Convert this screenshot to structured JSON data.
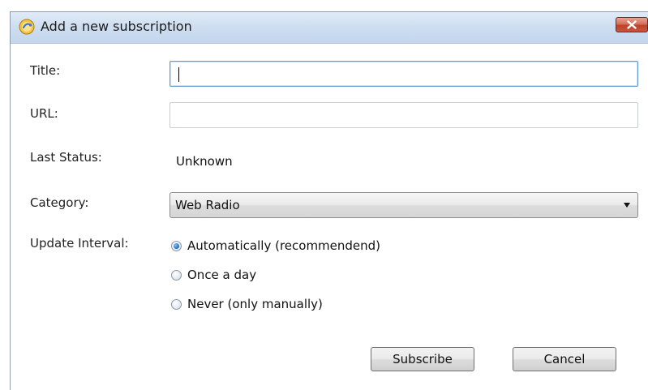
{
  "window": {
    "title": "Add a new subscription",
    "icon": "app-icon",
    "close_icon": "close-icon"
  },
  "form": {
    "title_label": "Title:",
    "title_value": "",
    "url_label": "URL:",
    "url_value": "",
    "status_label": "Last Status:",
    "status_value": "Unknown",
    "category_label": "Category:",
    "category_value": "Web Radio",
    "interval_label": "Update Interval:",
    "interval_options": [
      {
        "label": "Automatically (recommendend)",
        "checked": true
      },
      {
        "label": "Once a day",
        "checked": false
      },
      {
        "label": "Never (only manually)",
        "checked": false
      }
    ]
  },
  "buttons": {
    "subscribe": "Subscribe",
    "cancel": "Cancel"
  },
  "colors": {
    "titlebar": "#cfdff1",
    "close_button": "#c1412a",
    "focus_border": "#5d9ad6",
    "radio_selected": "#2b73c2"
  }
}
